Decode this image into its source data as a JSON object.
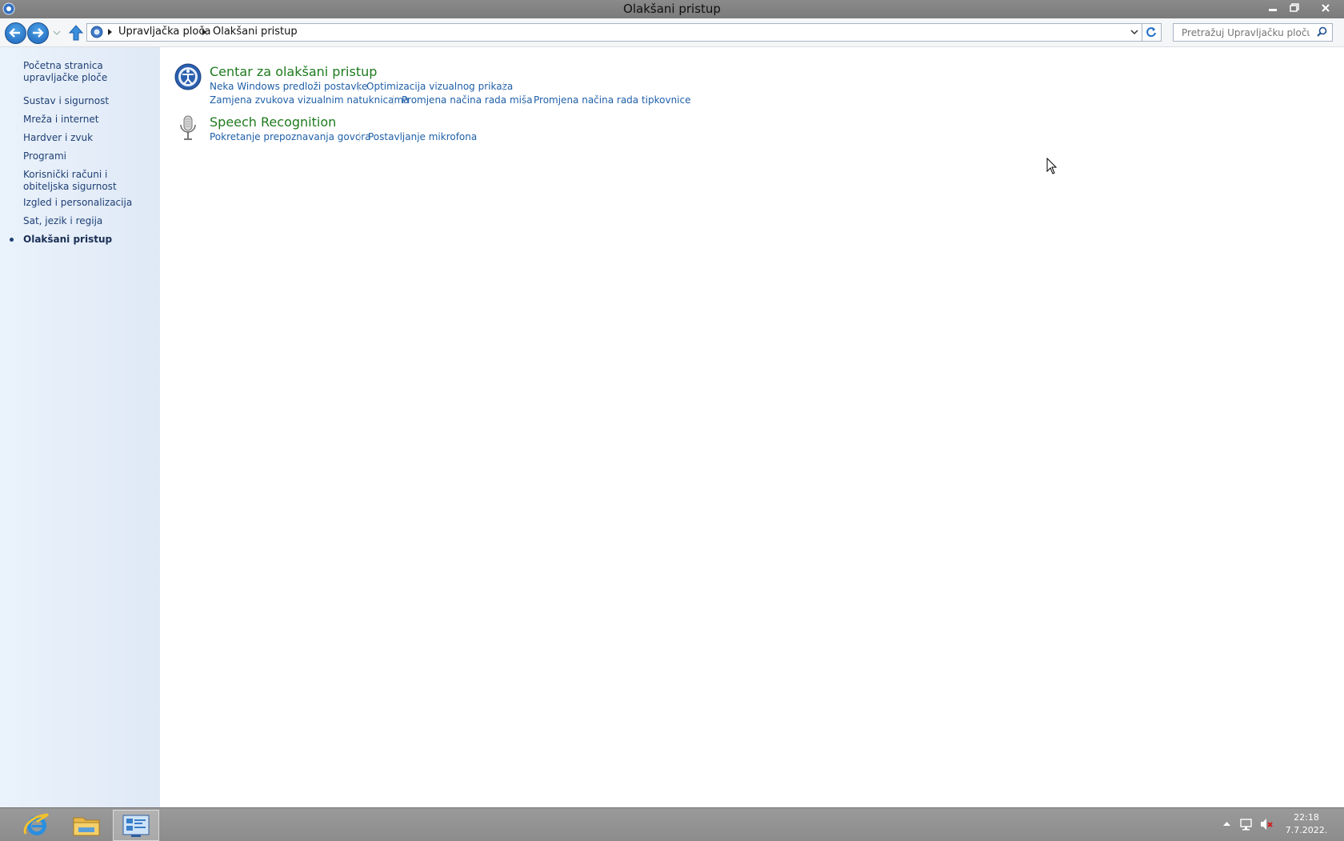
{
  "window": {
    "title": "Olakšani pristup",
    "controls": {
      "minimize": "–",
      "maximize": "▫",
      "close": "✕"
    }
  },
  "address": {
    "breadcrumbs": [
      "Upravljačka ploča",
      "Olakšani pristup"
    ]
  },
  "search": {
    "placeholder": "Pretražuj Upravljačku ploču"
  },
  "sidebar": {
    "items": [
      {
        "label": "Početna stranica upravljačke ploče"
      },
      {
        "label": "Sustav i sigurnost"
      },
      {
        "label": "Mreža i internet"
      },
      {
        "label": "Hardver i zvuk"
      },
      {
        "label": "Programi"
      },
      {
        "label": "Korisnički računi i obiteljska sigurnost"
      },
      {
        "label": "Izgled i personalizacija"
      },
      {
        "label": "Sat, jezik i regija"
      },
      {
        "label": "Olakšani pristup",
        "current": true
      }
    ]
  },
  "categories": [
    {
      "title": "Centar za olakšani pristup",
      "icon": "ease-of-access-icon",
      "links": [
        "Neka Windows predloži postavke",
        "Optimizacija vizualnog prikaza",
        "Zamjena zvukova vizualnim natuknicama",
        "Promjena načina rada miša",
        "Promjena načina rada tipkovnice"
      ]
    },
    {
      "title": "Speech Recognition",
      "icon": "microphone-icon",
      "links": [
        "Pokretanje prepoznavanja govora",
        "Postavljanje mikrofona"
      ]
    }
  ],
  "taskbar": {
    "apps": [
      "internet-explorer-icon",
      "file-explorer-icon",
      "control-panel-icon"
    ],
    "clock": {
      "time": "22:18",
      "date": "7.7.2022."
    }
  }
}
